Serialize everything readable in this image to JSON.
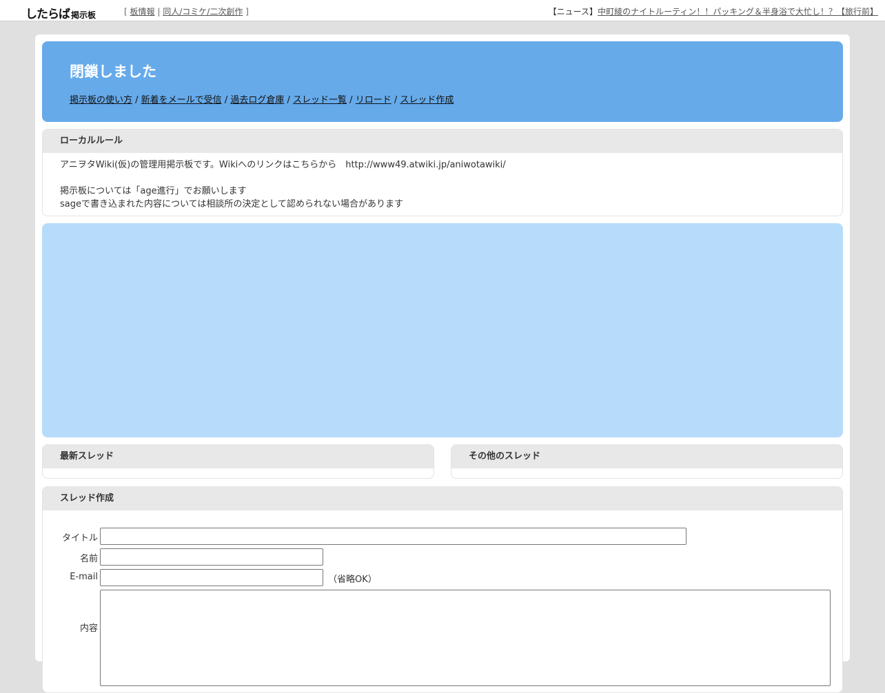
{
  "topbar": {
    "logo_main": "したらば",
    "logo_sub": "掲示板",
    "bracket_open": "[",
    "board_info": "板情報",
    "separator": "|",
    "category": "同人/コミケ/二次創作",
    "bracket_close": "]",
    "news_prefix": "【ニュース】",
    "news_link": "中町綾のナイトルーティン！！パッキング＆半身浴で大忙し！？【旅行前】"
  },
  "header": {
    "title": "閉鎖しました",
    "nav": [
      "掲示板の使い方",
      "新着をメールで受信",
      "過去ログ倉庫",
      "スレッド一覧",
      "リロード",
      "スレッド作成"
    ],
    "nav_sep": " / "
  },
  "local_rules": {
    "heading": "ローカルルール",
    "line1": "アニヲタWiki(仮)の管理用掲示板です。Wikiへのリンクはこちらから　http://www49.atwiki.jp/aniwotawiki/",
    "line2": "掲示板については「age進行」でお願いします",
    "line3": "sageで書き込まれた内容については相談所の決定として認められない場合があります"
  },
  "latest_threads": {
    "heading": "最新スレッド"
  },
  "other_threads": {
    "heading": "その他のスレッド"
  },
  "create_thread": {
    "heading": "スレッド作成",
    "title_label": "タイトル",
    "name_label": "名前",
    "email_label": "E-mail",
    "email_note": "（省略OK）",
    "content_label": "内容",
    "title_value": "",
    "name_value": "",
    "email_value": "",
    "content_value": ""
  },
  "colors": {
    "header_bg": "#66aaea",
    "ad_bg": "#b7dcfb",
    "box_head_bg": "#e8e8e8",
    "page_bg": "#e0e0e0"
  }
}
